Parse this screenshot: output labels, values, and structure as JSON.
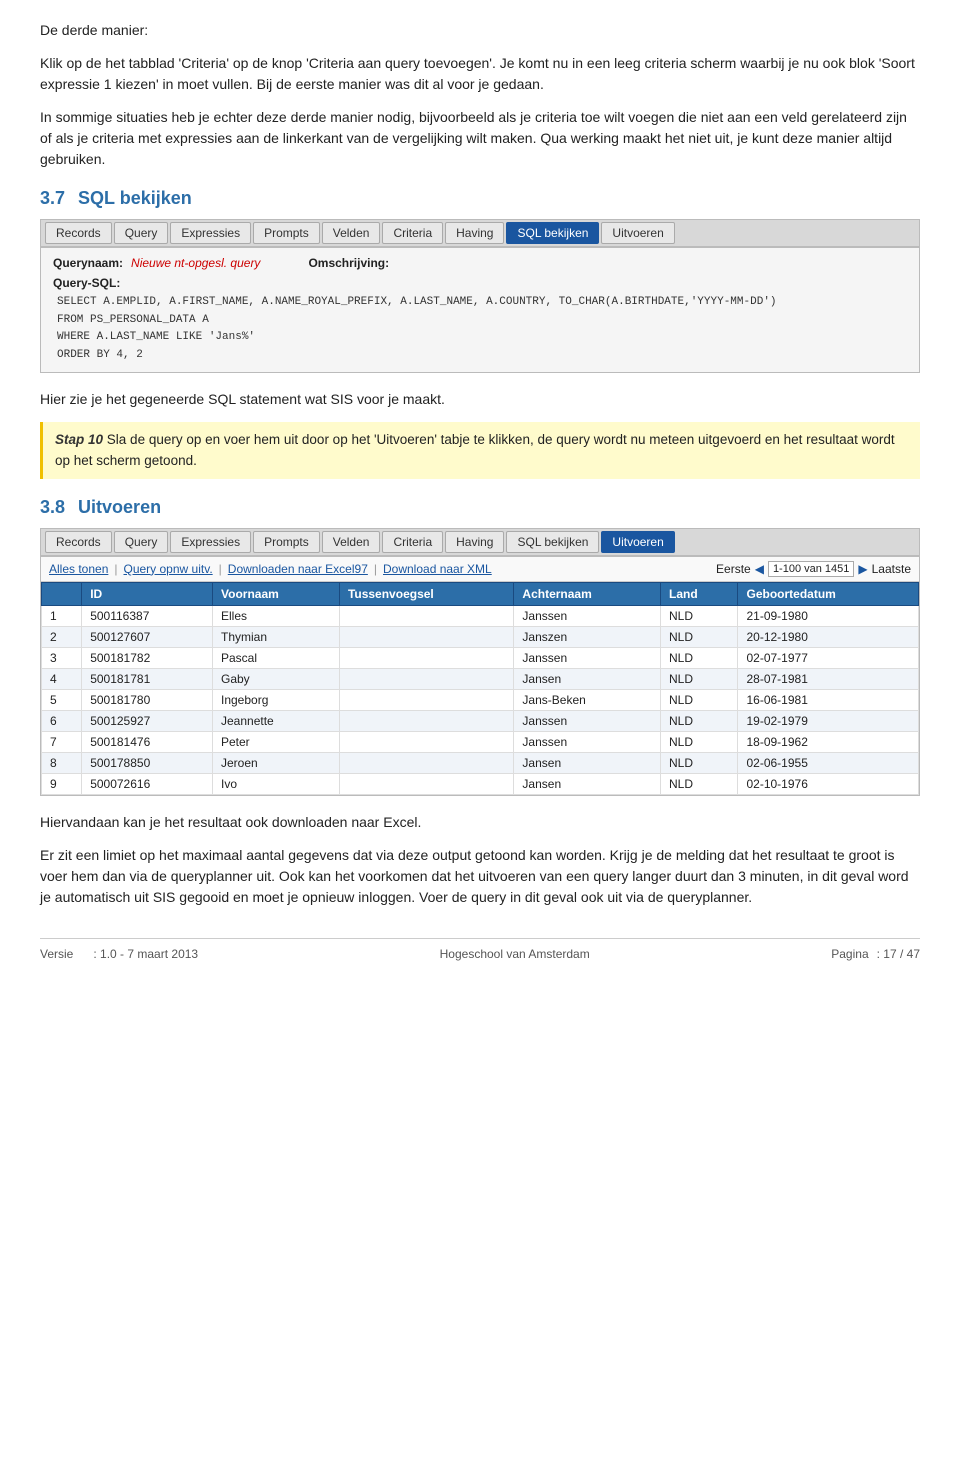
{
  "intro": {
    "para1": "De derde manier:",
    "para2": "Klik op de het tabblad 'Criteria' op de knop 'Criteria aan query toevoegen'. Je komt nu in een leeg criteria scherm waarbij je nu ook blok 'Soort expressie 1 kiezen' in moet vullen. Bij de eerste manier was dit al voor je gedaan.",
    "para3": "In sommige situaties heb je echter deze derde manier nodig, bijvoorbeeld als je criteria toe wilt voegen die niet aan een veld gerelateerd zijn of als je criteria met expressies aan de linkerkant van de vergelijking wilt maken. Qua werking maakt het niet uit, je kunt deze manier altijd gebruiken."
  },
  "section37": {
    "number": "3.7",
    "title": "SQL bekijken"
  },
  "tabbar1": {
    "tabs": [
      {
        "label": "Records",
        "state": "normal"
      },
      {
        "label": "Query",
        "state": "normal"
      },
      {
        "label": "Expressies",
        "state": "normal"
      },
      {
        "label": "Prompts",
        "state": "normal"
      },
      {
        "label": "Velden",
        "state": "normal"
      },
      {
        "label": "Criteria",
        "state": "normal"
      },
      {
        "label": "Having",
        "state": "normal"
      },
      {
        "label": "SQL bekijken",
        "state": "active"
      },
      {
        "label": "Uitvoeren",
        "state": "normal"
      }
    ]
  },
  "querybox1": {
    "querynaam_label": "Querynaam:",
    "querynaam_value": "Nieuwe nt-opgesl. query",
    "omschrijving_label": "Omschrijving:",
    "sql_label": "Query-SQL:",
    "sql_lines": [
      "SELECT A.EMPLID, A.FIRST_NAME, A.NAME_ROYAL_PREFIX, A.LAST_NAME, A.COUNTRY, TO_CHAR(A.BIRTHDATE,'YYYY-MM-DD')",
      "FROM PS_PERSONAL_DATA A",
      "WHERE A.LAST_NAME LIKE 'Jans%'",
      "ORDER BY 4, 2"
    ]
  },
  "para_sql": "Hier zie je het gegeneerde SQL statement wat SIS voor je maakt.",
  "step10": {
    "label": "Stap 10",
    "text": "Sla de query op en voer hem uit door op het 'Uitvoeren' tabje te klikken, de query wordt nu meteen uitgevoerd en het resultaat wordt op het scherm getoond."
  },
  "section38": {
    "number": "3.8",
    "title": "Uitvoeren"
  },
  "tabbar2": {
    "tabs": [
      {
        "label": "Records",
        "state": "normal"
      },
      {
        "label": "Query",
        "state": "normal"
      },
      {
        "label": "Expressies",
        "state": "normal"
      },
      {
        "label": "Prompts",
        "state": "normal"
      },
      {
        "label": "Velden",
        "state": "normal"
      },
      {
        "label": "Criteria",
        "state": "normal"
      },
      {
        "label": "Having",
        "state": "normal"
      },
      {
        "label": "SQL bekijken",
        "state": "normal"
      },
      {
        "label": "Uitvoeren",
        "state": "active"
      }
    ]
  },
  "results": {
    "toolbar_links": [
      "Alles tonen",
      "Query opnw uitv.",
      "Downloaden naar Excel97",
      "Download naar XML"
    ],
    "pagination_label_first": "Eerste",
    "pagination_range": "1-100 van 1451",
    "pagination_label_last": "Laatste",
    "columns": [
      "",
      "ID",
      "Voornaam",
      "Tussenvoegsel",
      "Achternaam",
      "Land",
      "Geboortedatum"
    ],
    "rows": [
      {
        "num": "1",
        "id": "500116387",
        "voornaam": "Elles",
        "tussenv": "",
        "achternaam": "Janssen",
        "land": "NLD",
        "geboortedatum": "21-09-1980"
      },
      {
        "num": "2",
        "id": "500127607",
        "voornaam": "Thymian",
        "tussenv": "",
        "achternaam": "Janszen",
        "land": "NLD",
        "geboortedatum": "20-12-1980"
      },
      {
        "num": "3",
        "id": "500181782",
        "voornaam": "Pascal",
        "tussenv": "",
        "achternaam": "Janssen",
        "land": "NLD",
        "geboortedatum": "02-07-1977"
      },
      {
        "num": "4",
        "id": "500181781",
        "voornaam": "Gaby",
        "tussenv": "",
        "achternaam": "Jansen",
        "land": "NLD",
        "geboortedatum": "28-07-1981"
      },
      {
        "num": "5",
        "id": "500181780",
        "voornaam": "Ingeborg",
        "tussenv": "",
        "achternaam": "Jans-Beken",
        "land": "NLD",
        "geboortedatum": "16-06-1981"
      },
      {
        "num": "6",
        "id": "500125927",
        "voornaam": "Jeannette",
        "tussenv": "",
        "achternaam": "Janssen",
        "land": "NLD",
        "geboortedatum": "19-02-1979"
      },
      {
        "num": "7",
        "id": "500181476",
        "voornaam": "Peter",
        "tussenv": "",
        "achternaam": "Janssen",
        "land": "NLD",
        "geboortedatum": "18-09-1962"
      },
      {
        "num": "8",
        "id": "500178850",
        "voornaam": "Jeroen",
        "tussenv": "",
        "achternaam": "Jansen",
        "land": "NLD",
        "geboortedatum": "02-06-1955"
      },
      {
        "num": "9",
        "id": "500072616",
        "voornaam": "Ivo",
        "tussenv": "",
        "achternaam": "Jansen",
        "land": "NLD",
        "geboortedatum": "02-10-1976"
      }
    ]
  },
  "para_download": "Hiervandaan kan je het resultaat ook downloaden naar Excel.",
  "para_limit1": "Er zit een limiet op het maximaal aantal gegevens dat via deze output getoond kan worden. Krijg je de melding dat het resultaat te groot is voer hem dan via de queryplanner uit. Ook kan het voorkomen dat het uitvoeren van een query langer duurt dan 3 minuten, in dit geval word je automatisch uit SIS gegooid en moet je opnieuw inloggen. Voer de query in dit geval ook uit via de queryplanner.",
  "footer": {
    "versie_label": "Versie",
    "versie_value": ": 1.0 - 7 maart 2013",
    "center": "Hogeschool van Amsterdam",
    "pagina_label": "Pagina",
    "pagina_value": ": 17 / 47"
  }
}
